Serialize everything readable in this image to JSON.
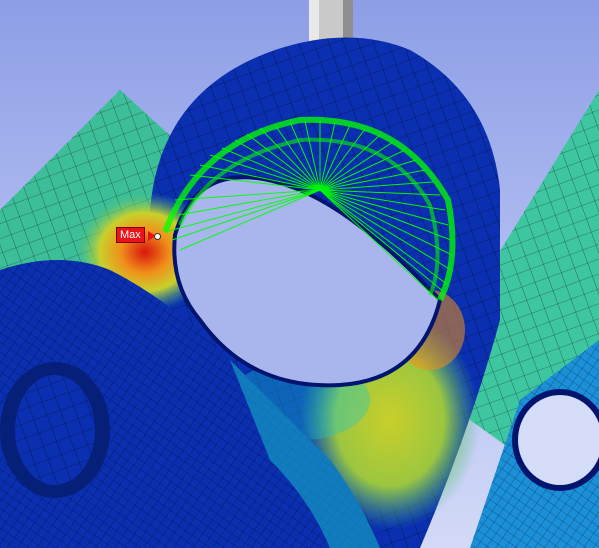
{
  "viewport": {
    "max_probe_label": "Max"
  },
  "colors": {
    "background": "#aebaf0",
    "contour_blue": "#0a2fb0",
    "contour_dark_blue": "#021a8c",
    "contour_cyan": "#18c8cf",
    "contour_green": "#3fbf8a",
    "contour_yellow": "#c8d12c",
    "contour_orange": "#f0901a",
    "contour_red": "#d8160e",
    "mesh_lines": "#000000",
    "force_vectors": "#00ff00",
    "pin": "#c9c9c9",
    "max_label_bg": "#e8141a"
  },
  "scene": {
    "description_icons": [
      "pin-icon",
      "mesh-icon",
      "force-vector-icon"
    ]
  }
}
